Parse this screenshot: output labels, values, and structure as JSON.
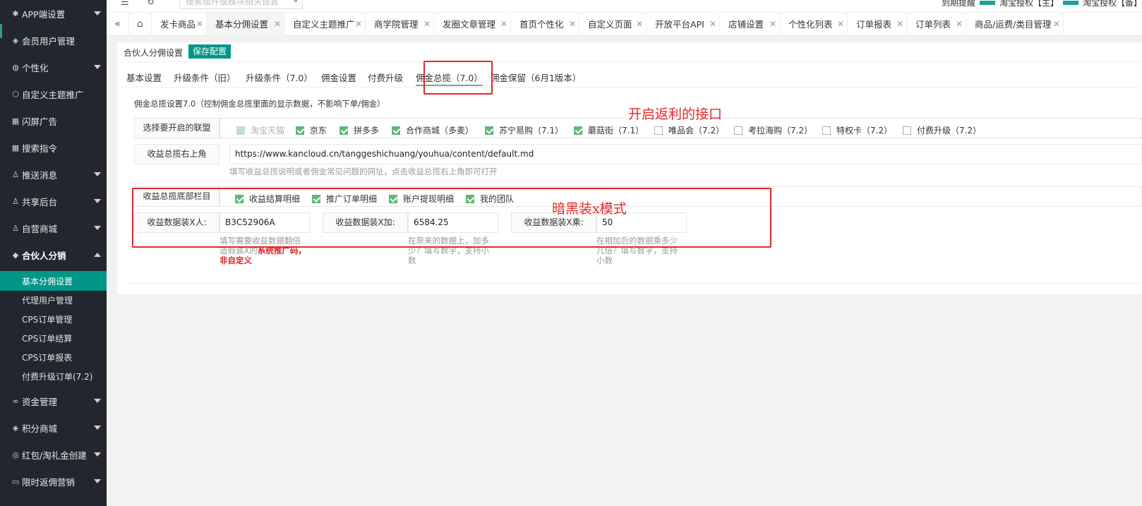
{
  "sidebar": {
    "items": [
      {
        "label": "APP端设置",
        "icon": "gear-icon",
        "caret": true
      },
      {
        "label": "会员用户管理",
        "icon": "shield-icon",
        "caret": false
      },
      {
        "label": "个性化",
        "icon": "palette-icon",
        "caret": true
      },
      {
        "label": "自定义主题推广",
        "icon": "cube-icon",
        "caret": false
      },
      {
        "label": "闪屏广告",
        "icon": "grid-icon",
        "caret": false
      },
      {
        "label": "搜索指令",
        "icon": "grid-icon",
        "caret": false
      },
      {
        "label": "推送消息",
        "icon": "user-icon",
        "caret": true
      },
      {
        "label": "共享后台",
        "icon": "user-icon",
        "caret": true
      },
      {
        "label": "自营商城",
        "icon": "user-icon",
        "caret": true
      },
      {
        "label": "合伙人分销",
        "icon": "layers-icon",
        "caret": true
      },
      {
        "label": "资金管理",
        "icon": "link-icon",
        "caret": true
      },
      {
        "label": "积分商城",
        "icon": "shield-icon",
        "caret": true
      },
      {
        "label": "红包/淘礼金创建",
        "icon": "compass-icon",
        "caret": true
      },
      {
        "label": "限时返佣营销",
        "icon": "box-icon",
        "caret": true
      }
    ],
    "sub_items": [
      "基本分佣设置",
      "代理用户管理",
      "CPS订单管理",
      "CPS订单结算",
      "CPS订单报表",
      "付费升级订单(7.2)"
    ]
  },
  "topbar": {
    "search_placeholder": "搜索组件或模块相关设置",
    "right": [
      "到期提醒",
      "淘宝授权【主】",
      "淘宝授权【备】"
    ]
  },
  "tabs": [
    "发卡商品",
    "基本分佣设置",
    "自定义主题推广",
    "商学院管理",
    "发圈文章管理",
    "首页个性化",
    "自定义页面",
    "开放平台API",
    "店铺设置",
    "个性化列表",
    "订单报表",
    "订单列表",
    "商品/运费/类目管理"
  ],
  "card": {
    "title": "合伙人分佣设置",
    "save_label": "保存配置",
    "subtabs": [
      "基本设置",
      "升级条件（旧）",
      "升级条件（7.0）",
      "佣金设置",
      "付费升级",
      "佣金总揽（7.0）",
      "佣金保留（6月1版本）"
    ],
    "description": "佣金总揽设置7.0（控制佣金总揽里面的显示数据，不影响下单/佣金）",
    "alliance_label": "选择要开启的联盟",
    "alliances": [
      {
        "label": "淘宝天猫",
        "state": "disabled"
      },
      {
        "label": "京东",
        "state": "on"
      },
      {
        "label": "拼多多",
        "state": "on"
      },
      {
        "label": "合作商城（多麦）",
        "state": "on"
      },
      {
        "label": "苏宁易购（7.1）",
        "state": "on"
      },
      {
        "label": "蘑菇街（7.1）",
        "state": "on"
      },
      {
        "label": "唯品会（7.2）",
        "state": "off"
      },
      {
        "label": "考拉海购（7.2）",
        "state": "off"
      },
      {
        "label": "特权卡（7.2）",
        "state": "off"
      },
      {
        "label": "付费升级（7.2）",
        "state": "off"
      }
    ],
    "topright_label": "收益总揽右上角",
    "topright_url": "https://www.kancloud.cn/tanggeshichuang/youhua/content/default.md",
    "topright_hint": "填写收益总揽说明或者佣金常见问题的网址，点击收益总揽右上角即可打开",
    "bottom_label": "收益总揽底部栏目",
    "bottom_items": [
      "收益结算明细",
      "推广订单明细",
      "账户提现明细",
      "我的团队"
    ],
    "fake_person_label": "收益数据装X人:",
    "fake_person_value": "B3C52906A",
    "fake_person_hint_a": "填写需要收益数据翻倍造假装X的",
    "fake_person_hint_b": "系统推广码，非自定义",
    "fake_add_label": "收益数据装X加:",
    "fake_add_value": "6584.25",
    "fake_add_hint": "在原来的数据上，加多少？填写数字，支持小数",
    "fake_mul_label": "收益数据装X乘:",
    "fake_mul_value": "50",
    "fake_mul_hint": "在相加后的数据乘多少几倍？填写数字，支持小数"
  },
  "annotations": {
    "rebate_api": "开启返利的接口",
    "dark_mode": "暗黑装x模式",
    "color": "#e8262b"
  },
  "colors": {
    "accent": "#009688",
    "sidebar_bg": "#23262e",
    "check_green": "#5fb878"
  }
}
